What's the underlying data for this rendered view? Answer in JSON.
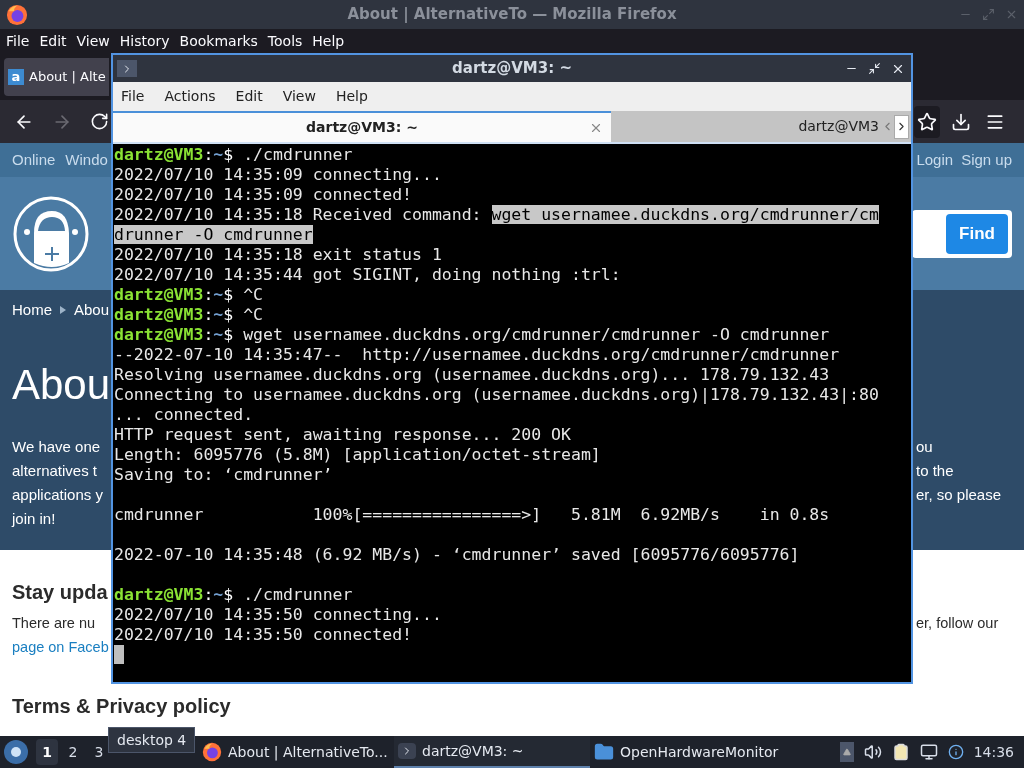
{
  "browser": {
    "title": "About | AlternativeTo — Mozilla Firefox",
    "menu": [
      "File",
      "Edit",
      "View",
      "History",
      "Bookmarks",
      "Tools",
      "Help"
    ],
    "tab": {
      "label": "About | Alte",
      "icon_letter": "a"
    },
    "nav_left": [
      {
        "kind": "back",
        "disabled": false
      },
      {
        "kind": "forward",
        "disabled": true
      },
      {
        "kind": "reload",
        "disabled": false
      }
    ],
    "nav_right": [
      {
        "kind": "bookmark"
      },
      {
        "kind": "downloads"
      },
      {
        "kind": "menu"
      }
    ]
  },
  "page": {
    "top_links_left": [
      "Online",
      "Windo"
    ],
    "top_links_right": [
      "Login",
      "Sign up"
    ],
    "search_button": "Find",
    "breadcrumb": [
      "Home",
      "Abou"
    ],
    "heading": "Abou",
    "intro_left": [
      "We have one",
      "alternatives t",
      "applications y",
      "join in!"
    ],
    "intro_right": [
      "ou",
      "to the",
      "er, so please"
    ],
    "section_heading": "Stay upda",
    "section_left": "There are nu",
    "section_link": "page on Faceb",
    "section_right": "er, follow our",
    "footer_heading": "Terms & Privacy policy"
  },
  "terminal": {
    "title": "dartz@VM3: ~",
    "menu": [
      "File",
      "Actions",
      "Edit",
      "View",
      "Help"
    ],
    "tabs": [
      {
        "label": "dartz@VM3: ~",
        "selected": true
      },
      {
        "label": "dartz@VM3",
        "selected": false
      }
    ],
    "lines": [
      {
        "kind": "prompt",
        "user": "dartz@VM3",
        "separator": ":",
        "path": "~",
        "symbol": "$",
        "command": "./cmdrunner"
      },
      {
        "kind": "output",
        "text": "2022/07/10 14:35:09 connecting..."
      },
      {
        "kind": "output",
        "text": "2022/07/10 14:35:09 connected!"
      },
      {
        "kind": "output",
        "text": "2022/07/10 14:35:18 Received command: ",
        "selection": "wget usernamee.duckdns.org/cmdrunner/cm"
      },
      {
        "kind": "output",
        "selection": "drunner -O cmdrunner"
      },
      {
        "kind": "output",
        "text": "2022/07/10 14:35:18 exit status 1"
      },
      {
        "kind": "output",
        "text": "2022/07/10 14:35:44 got SIGINT, doing nothing :trl:"
      },
      {
        "kind": "prompt",
        "user": "dartz@VM3",
        "separator": ":",
        "path": "~",
        "symbol": "$",
        "command": "^C"
      },
      {
        "kind": "prompt",
        "user": "dartz@VM3",
        "separator": ":",
        "path": "~",
        "symbol": "$",
        "command": "^C"
      },
      {
        "kind": "prompt",
        "user": "dartz@VM3",
        "separator": ":",
        "path": "~",
        "symbol": "$",
        "command": "wget usernamee.duckdns.org/cmdrunner/cmdrunner -O cmdrunner"
      },
      {
        "kind": "output",
        "text": "--2022-07-10 14:35:47--  http://usernamee.duckdns.org/cmdrunner/cmdrunner"
      },
      {
        "kind": "output",
        "text": "Resolving usernamee.duckdns.org (usernamee.duckdns.org)... 178.79.132.43"
      },
      {
        "kind": "output",
        "text": "Connecting to usernamee.duckdns.org (usernamee.duckdns.org)|178.79.132.43|:80"
      },
      {
        "kind": "output",
        "text": "... connected."
      },
      {
        "kind": "output",
        "text": "HTTP request sent, awaiting response... 200 OK"
      },
      {
        "kind": "output",
        "text": "Length: 6095776 (5.8M) [application/octet-stream]"
      },
      {
        "kind": "output",
        "text": "Saving to: ‘cmdrunner’"
      },
      {
        "kind": "blank"
      },
      {
        "kind": "output",
        "text": "cmdrunner           100%[================>]   5.81M  6.92MB/s    in 0.8s"
      },
      {
        "kind": "blank"
      },
      {
        "kind": "output",
        "text": "2022-07-10 14:35:48 (6.92 MB/s) - ‘cmdrunner’ saved [6095776/6095776]"
      },
      {
        "kind": "blank"
      },
      {
        "kind": "prompt",
        "user": "dartz@VM3",
        "separator": ":",
        "path": "~",
        "symbol": "$",
        "command": "./cmdrunner"
      },
      {
        "kind": "output",
        "text": "2022/07/10 14:35:50 connecting..."
      },
      {
        "kind": "output",
        "text": "2022/07/10 14:35:50 connected!"
      },
      {
        "kind": "cursor"
      }
    ]
  },
  "taskbar": {
    "workspaces": [
      {
        "label": "1",
        "selected": true
      },
      {
        "label": "2",
        "selected": false
      },
      {
        "label": "3",
        "selected": false
      }
    ],
    "tooltip": "desktop 4",
    "tasks": [
      {
        "kind": "browser",
        "label": "About | AlternativeTo...",
        "selected": false
      },
      {
        "kind": "terminal",
        "label": "dartz@VM3: ~",
        "selected": true
      },
      {
        "kind": "folder",
        "label": "OpenHardwareMonitor",
        "selected": false
      }
    ],
    "clock": "14:36"
  }
}
